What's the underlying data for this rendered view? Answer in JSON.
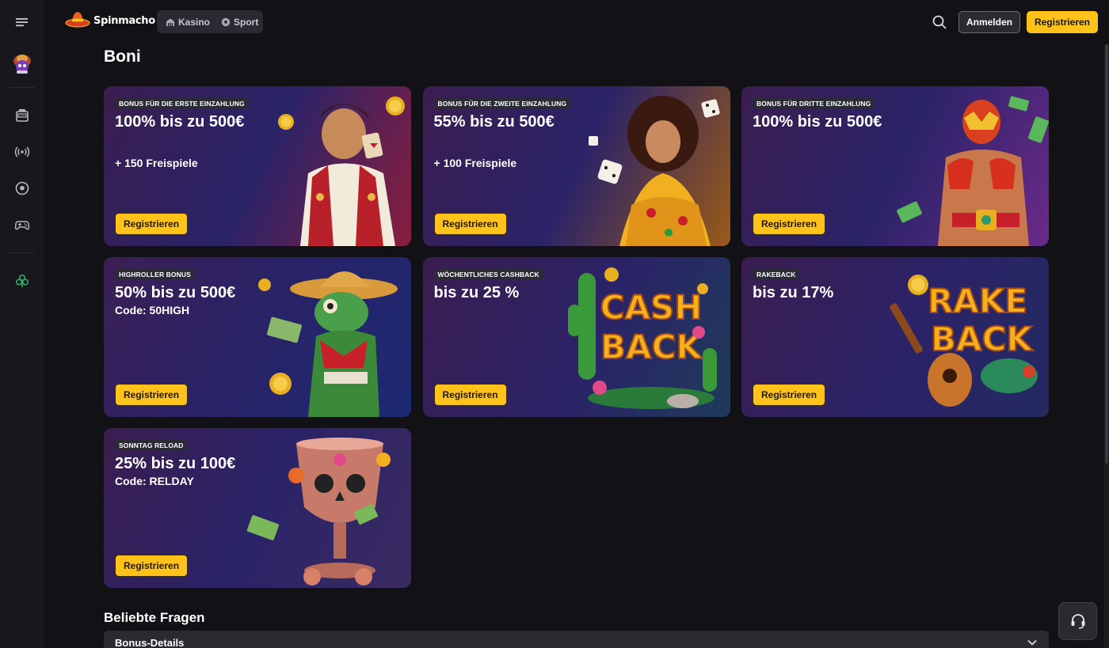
{
  "app": {
    "brand": "Spinmacho"
  },
  "header": {
    "nav": [
      {
        "label": "Kasino",
        "icon": "casino-icon"
      },
      {
        "label": "Sport",
        "icon": "soccer-ball-icon"
      }
    ],
    "login_label": "Anmelden",
    "register_label": "Registrieren"
  },
  "sidebar": {
    "items": [
      {
        "icon": "slot-machine-icon"
      },
      {
        "icon": "live-broadcast-icon"
      },
      {
        "icon": "sports-ball-icon"
      },
      {
        "icon": "gamepad-icon"
      },
      {
        "icon": "clover-icon"
      }
    ]
  },
  "page": {
    "title": "Boni"
  },
  "bonuses": [
    {
      "tag": "Bonus für die erste Einzahlung",
      "headline": "100% bis zu 500€",
      "sub": "+ 150 Freispiele",
      "cta": "Registrieren"
    },
    {
      "tag": "Bonus für die zweite Einzahlung",
      "headline": "55% bis zu 500€",
      "sub": "+ 100 Freispiele",
      "cta": "Registrieren"
    },
    {
      "tag": "Bonus für dritte Einzahlung",
      "headline": "100% bis zu 500€",
      "sub": "",
      "cta": "Registrieren"
    },
    {
      "tag": "Highroller Bonus",
      "headline": "50% bis zu 500€",
      "sub": "Code: 50HIGH",
      "cta": "Registrieren"
    },
    {
      "tag": "Wöchentliches Cashback",
      "headline": "bis zu 25 %",
      "sub": "",
      "cta": "Registrieren",
      "art_text": [
        "CASH",
        "BACK"
      ]
    },
    {
      "tag": "Rakeback",
      "headline": "bis zu 17%",
      "sub": "",
      "cta": "Registrieren",
      "art_text": [
        "RAKE",
        "BACK"
      ]
    },
    {
      "tag": "Sonntag Reload",
      "headline": "25% bis zu 100€",
      "sub": "Code: RELDAY",
      "cta": "Registrieren"
    }
  ],
  "faq": {
    "title": "Beliebte Fragen",
    "items": [
      {
        "question": "Bonus-Details"
      }
    ]
  },
  "colors": {
    "accent": "#ffc21a",
    "background": "#111116",
    "sidebar": "#17171d"
  }
}
